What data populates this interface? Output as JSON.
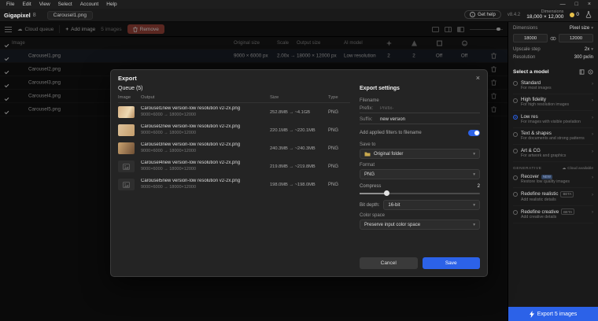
{
  "colors": {
    "accent_blue": "#2c62e8",
    "danger_red": "#a5473c"
  },
  "icons": {
    "cloud": "☁",
    "plus": "+",
    "chevron_down": "▾",
    "chevron_right": "›",
    "minimize": "—",
    "maximize": "□",
    "close": "×",
    "info": "i"
  },
  "menu_bar": {
    "items": [
      "File",
      "Edit",
      "View",
      "Select",
      "Account",
      "Help"
    ]
  },
  "title_bar": {
    "app_name": "Gigapixel",
    "app_version": "8",
    "tab": "Carousel1.png",
    "get_help": "Get help",
    "version": "v8.4.2",
    "dimensions_label": "Dimensions",
    "dimensions_value": "18,000 × 12,000",
    "credits": "0"
  },
  "toolbar": {
    "cloud_queue": "Cloud queue",
    "add_image": "Add image",
    "image_count": "5 images",
    "remove": "Remove"
  },
  "file_list": {
    "columns": {
      "image": "Image",
      "original_size": "Original size",
      "scale": "Scale",
      "output_size": "Output size",
      "ai_model": "AI model"
    },
    "rows": [
      {
        "name": "Carousel1.png",
        "original_size": "9000 × 6000 px",
        "scale": "2.00x →",
        "output_size": "18000 × 12000 px",
        "ai_model": "Low resolution",
        "denoise": "2",
        "sharpen": "2",
        "compression": "Off",
        "face_recovery": "Off"
      },
      {
        "name": "Carousel2.png"
      },
      {
        "name": "Carousel3.png"
      },
      {
        "name": "Carousel4.png"
      },
      {
        "name": "Carousel5.png"
      }
    ]
  },
  "export_modal": {
    "title": "Export",
    "queue_heading": "Queue (5)",
    "queue_columns": {
      "image": "Image",
      "output": "Output",
      "size": "Size",
      "type": "Type"
    },
    "queue_rows": [
      {
        "name": "Carousel1new version-low resolution v2-2x.png",
        "dimensions": "9000×6000 → 18000×12000",
        "size": "252.8MB → ~4.1GB",
        "type": "PNG"
      },
      {
        "name": "Carousel2new version-low resolution v2-2x.png",
        "dimensions": "9000×6000 → 18000×12000",
        "size": "220.1MB → ~220.1MB",
        "type": "PNG"
      },
      {
        "name": "Carousel3new version-low resolution v2-2x.png",
        "dimensions": "9000×6000 → 18000×12000",
        "size": "240.3MB → ~240.3MB",
        "type": "PNG"
      },
      {
        "name": "Carousel4new version-low resolution v2-2x.png",
        "dimensions": "9000×6000 → 18000×12000",
        "size": "219.8MB → ~219.8MB",
        "type": "PNG"
      },
      {
        "name": "Carousel5new version-low resolution v2-2x.png",
        "dimensions": "9000×6000 → 18000×12000",
        "size": "198.0MB → ~198.0MB",
        "type": "PNG"
      }
    ],
    "settings": {
      "heading": "Export settings",
      "filename_label": "Filename",
      "prefix_label": "Prefix:",
      "prefix_placeholder": "Prefix-",
      "suffix_label": "Suffix:",
      "suffix_value": "new version",
      "filters_toggle_label": "Add applied filters to filename",
      "save_to_label": "Save to",
      "save_to_value": "Original folder",
      "format_label": "Format",
      "format_value": "PNG",
      "compress_label": "Compress",
      "compress_value": "2",
      "bit_depth_label": "Bit depth:",
      "bit_depth_value": "16-bit",
      "color_space_label": "Color space",
      "color_space_value": "Preserve input color space",
      "cancel_button": "Cancel",
      "save_button": "Save"
    }
  },
  "sidebar": {
    "dimensions": {
      "header": "Dimensions",
      "unit_value": "Pixel size",
      "width": "18000",
      "height": "12000",
      "upscale_label": "Upscale step",
      "upscale_value": "2x",
      "resolution_label": "Resolution",
      "resolution_value": "300 px/in"
    },
    "model_section": {
      "heading": "Select a model",
      "models": [
        {
          "name": "Standard",
          "desc": "For most images",
          "selected": false
        },
        {
          "name": "High fidelity",
          "desc": "For high resolution images",
          "selected": false
        },
        {
          "name": "Low res",
          "desc": "For images with visible pixelation",
          "selected": true
        },
        {
          "name": "Text & shapes",
          "desc": "For documents and strong patterns",
          "selected": false
        },
        {
          "name": "Art & CG",
          "desc": "For artwork and graphics",
          "selected": false
        }
      ],
      "generative_label": "GENERATIVE",
      "cloud_available": "Cloud available",
      "generative_models": [
        {
          "name": "Recover",
          "badge": "NEW",
          "desc": "Restore low quality images"
        },
        {
          "name": "Redefine realistic",
          "badge": "BETA",
          "desc": "Add realistic details"
        },
        {
          "name": "Redefine creative",
          "badge": "BETA",
          "desc": "Add creative details"
        }
      ]
    },
    "export_button": "Export 5 images"
  }
}
